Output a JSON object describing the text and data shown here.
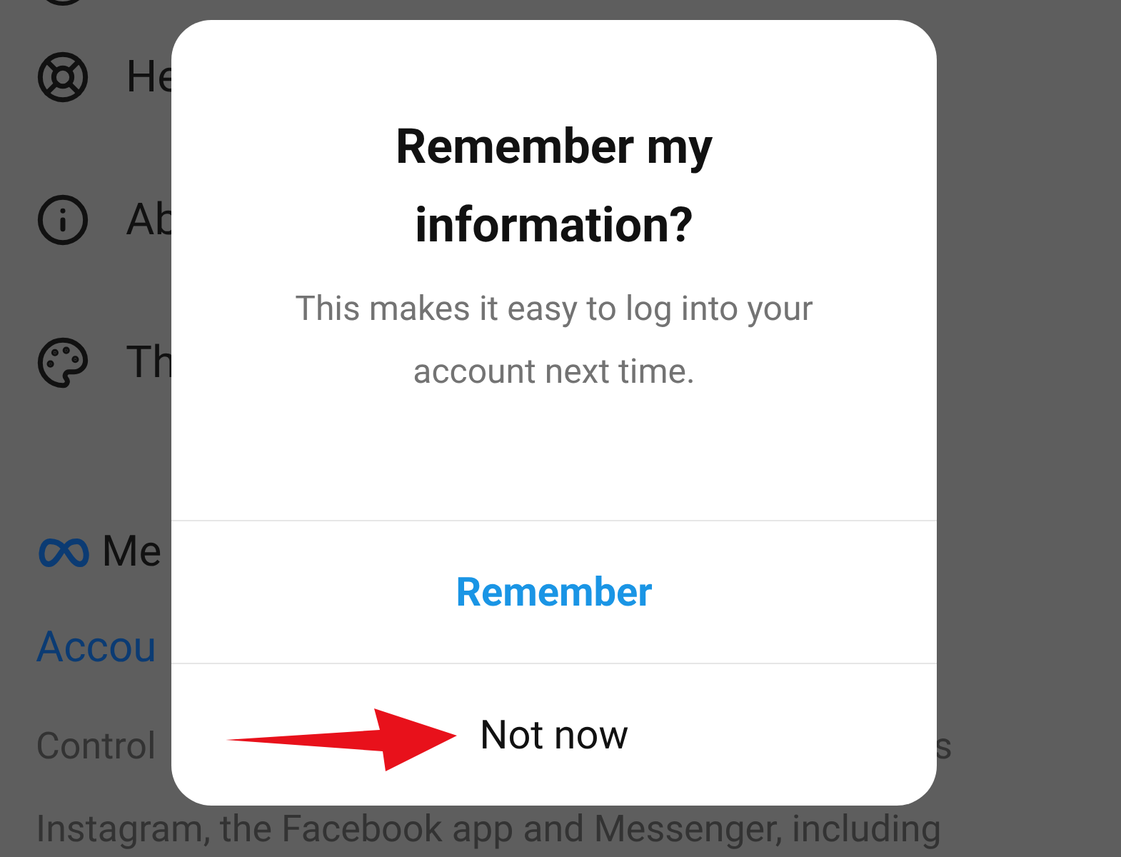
{
  "background": {
    "menu_items": [
      {
        "kind": "help",
        "label": "He"
      },
      {
        "kind": "info",
        "label": "Ab"
      },
      {
        "kind": "theme",
        "label": "Th"
      }
    ],
    "meta_label": "Me",
    "link": "Accou",
    "description_left": "Control",
    "description_right": "s",
    "description_line_2": "Instagram, the Facebook app and Messenger, including"
  },
  "dialog": {
    "title": "Remember my information?",
    "message": "This makes it easy to log into your account next time.",
    "actions": [
      {
        "label": "Remember",
        "kind": "primary"
      },
      {
        "label": "Not now",
        "kind": "secondary"
      }
    ]
  },
  "annotation": {
    "kind": "arrow"
  }
}
